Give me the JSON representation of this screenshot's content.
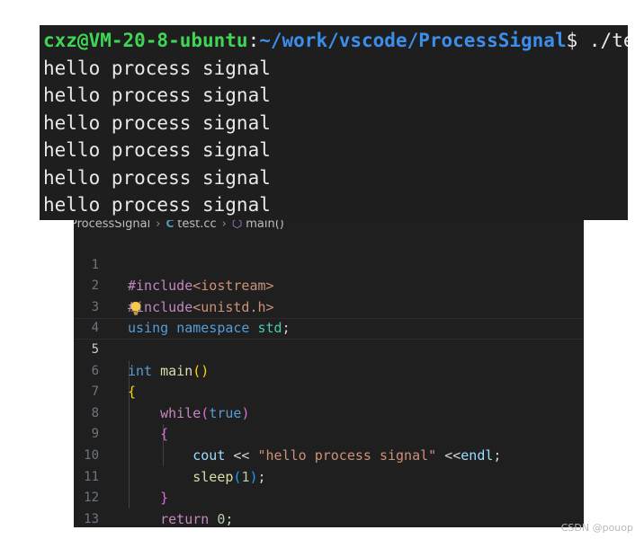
{
  "terminal": {
    "prompt_user": "cxz@VM-20-8-ubuntu",
    "prompt_sep": ":",
    "prompt_path": "~/work/vscode/ProcessSignal",
    "prompt_symbol": "$",
    "command": " ./test",
    "output_lines": [
      "hello process signal",
      "hello process signal",
      "hello process signal",
      "hello process signal",
      "hello process signal",
      "hello process signal"
    ],
    "colors": {
      "user": "#3fd655",
      "path": "#3b8eea",
      "background": "#1e1e1e"
    }
  },
  "editor": {
    "breadcrumb": {
      "folder": "ProcessSignal",
      "file_icon": "cpp-file-icon",
      "file": "test.cc",
      "symbol_icon": "function-icon",
      "symbol": "main()"
    },
    "line_numbers": [
      "1",
      "2",
      "3",
      "4",
      "5",
      "6",
      "7",
      "8",
      "9",
      "10",
      "11",
      "12",
      "13"
    ],
    "current_line": "5",
    "lines": {
      "l1": {
        "pre": "#include",
        "inc": "<iostream>"
      },
      "l2": {
        "pre": "#include",
        "inc": "<unistd.h>"
      },
      "l3": {
        "kw1": "using",
        "kw2": "namespace",
        "ns": "std",
        "end": ";"
      },
      "l4": {
        "icon": "lightbulb-icon"
      },
      "l5": {
        "kw": "int",
        "fn": "main",
        "p": "()"
      },
      "l6": {
        "brace": "{"
      },
      "l7": {
        "ctl": "while",
        "open": "(",
        "kw": "true",
        "close": ")"
      },
      "l8": {
        "brace": "{"
      },
      "l9": {
        "id": "cout",
        "op1": " << ",
        "str": "\"hello process signal\"",
        "op2": " <<",
        "id2": "endl",
        "end": ";"
      },
      "l10": {
        "fn": "sleep",
        "open": "(",
        "num": "1",
        "close": ")",
        "end": ";"
      },
      "l11": {
        "brace": "}"
      },
      "l12": {
        "ctl": "return",
        "num": "0",
        "end": ";"
      },
      "l13": {
        "brace": "}"
      }
    },
    "colors": {
      "background": "#1f1f1f",
      "keyword": "#569cd6",
      "control": "#c586c0",
      "function": "#dcdcaa",
      "string": "#ce9178",
      "number": "#b5cea8"
    }
  },
  "watermark": "CSDN @pouop"
}
